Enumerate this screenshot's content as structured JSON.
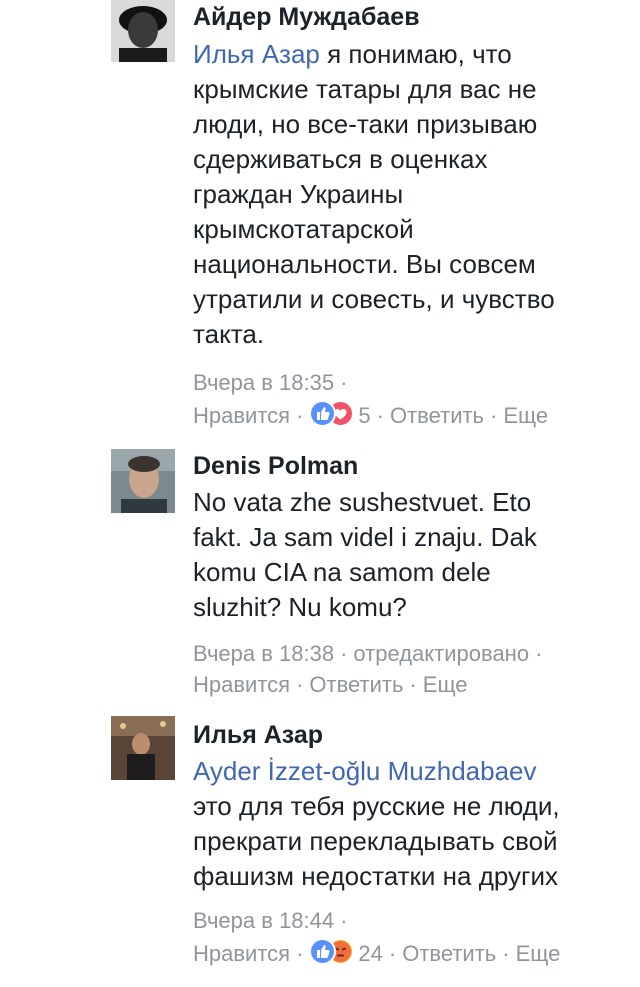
{
  "comments": [
    {
      "author": "Айдер Муждабаев",
      "mention": "Илья Азар",
      "text_lines": [
        "я понимаю, что",
        "крымские татары для вас не",
        "люди, но все-таки призываю",
        "сдерживаться в оценках",
        "граждан Украины",
        "крымскотатарской",
        "национальности. Вы совсем",
        "утратили и совесть, и чувство",
        "такта."
      ],
      "time": "Вчера в 18:35",
      "edited": "",
      "like_label": "Нравится",
      "reactions": [
        "like-icon",
        "love-icon"
      ],
      "reaction_count": "5",
      "reply_label": "Ответить",
      "more_label": "Еще"
    },
    {
      "author": "Denis Polman",
      "mention": "",
      "text_lines": [
        "No vata zhe sushestvuet. Eto",
        "fakt. Ja sam videl i znaju. Dak",
        "komu CIA na samom dele",
        "sluzhit? Nu komu?"
      ],
      "time": "Вчера в 18:38",
      "edited": "отредактировано",
      "like_label": "Нравится",
      "reply_label": "Ответить",
      "more_label": "Еще"
    },
    {
      "author": "Илья Азар",
      "mention": "Ayder İzzet-oğlu Muzhdabaev",
      "text_lines": [
        "это для тебя русские не люди,",
        "прекрати перекладывать свой",
        "фашизм недостатки на других"
      ],
      "time": "Вчера в 18:44",
      "edited": "",
      "like_label": "Нравится",
      "reactions": [
        "like-icon",
        "angry-icon"
      ],
      "reaction_count": "24",
      "reply_label": "Ответить",
      "more_label": "Еще"
    }
  ],
  "colors": {
    "text": "#1d2129",
    "link": "#4267b2",
    "meta": "#90949c",
    "like": "#5890ff",
    "love": "#f25268",
    "angry": "#f7b125"
  }
}
